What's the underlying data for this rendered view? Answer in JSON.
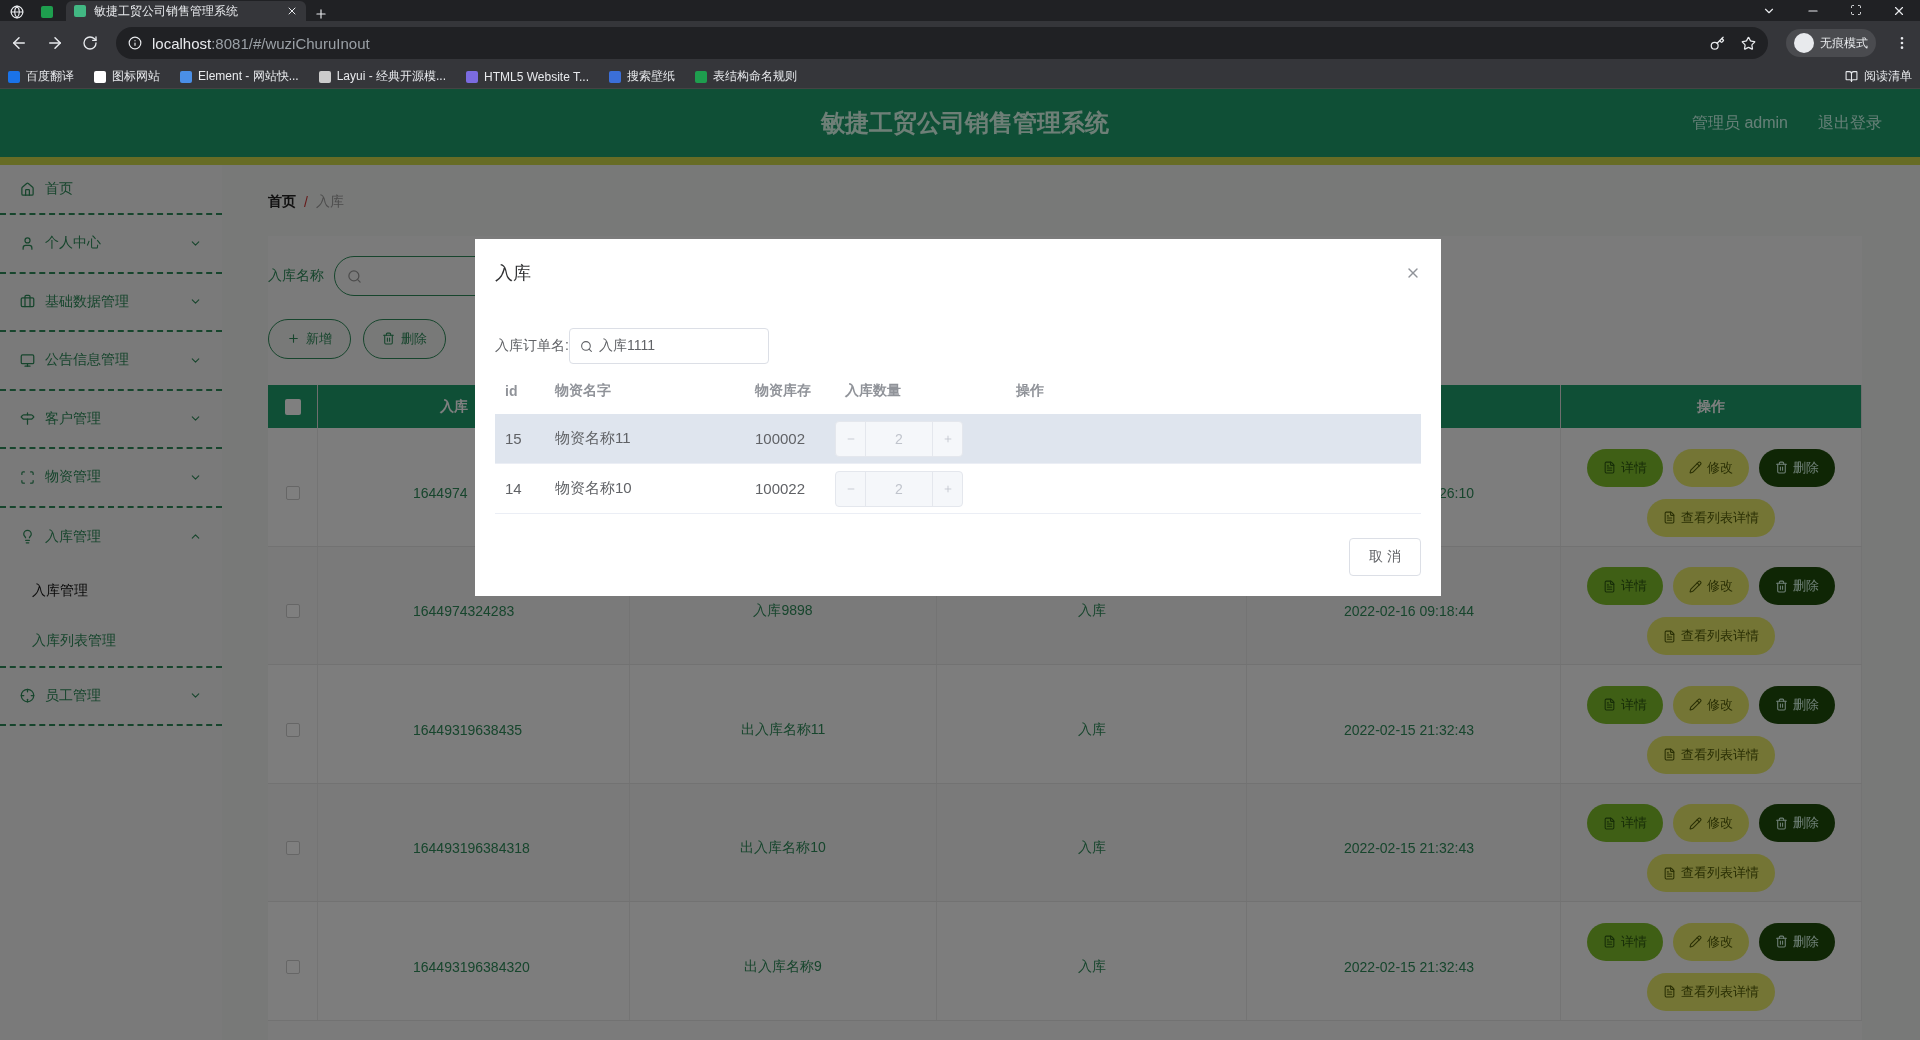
{
  "browser": {
    "tab_title": "敏捷工贸公司销售管理系统",
    "url_host": "localhost",
    "url_rest": ":8081/#/wuziChuruInout",
    "profile": "无痕模式",
    "bookmarks": [
      "百度翻译",
      "图标网站",
      "Element - 网站快...",
      "Layui - 经典开源模...",
      "HTML5 Website T...",
      "搜索壁纸",
      "表结构命名规则"
    ],
    "reading_list": "阅读清单"
  },
  "header": {
    "title": "敏捷工贸公司销售管理系统",
    "user": "管理员 admin",
    "logout": "退出登录"
  },
  "sidebar": {
    "items": [
      {
        "label": "首页",
        "kind": "link"
      },
      {
        "label": "个人中心",
        "kind": "menu",
        "expanded": false
      },
      {
        "label": "基础数据管理",
        "kind": "menu",
        "expanded": false
      },
      {
        "label": "公告信息管理",
        "kind": "menu",
        "expanded": false
      },
      {
        "label": "客户管理",
        "kind": "menu",
        "expanded": false
      },
      {
        "label": "物资管理",
        "kind": "menu",
        "expanded": false
      },
      {
        "label": "入库管理",
        "kind": "menu",
        "expanded": true,
        "children": [
          {
            "label": "入库管理",
            "selected": true
          },
          {
            "label": "入库列表管理",
            "selected": false
          }
        ]
      },
      {
        "label": "员工管理",
        "kind": "menu",
        "expanded": false
      }
    ]
  },
  "breadcrumb": {
    "items": [
      "首页",
      "入库"
    ],
    "separator": "/"
  },
  "search": {
    "label": "入库名称"
  },
  "actions": [
    {
      "label": "新增",
      "kind": "add"
    },
    {
      "label": "删除",
      "kind": "delete"
    }
  ],
  "table": {
    "select_all": {
      "checked": false
    },
    "columns": [
      "入库",
      "操作"
    ],
    "rows": [
      {
        "number": "1644974",
        "time": "26:10",
        "checked": false,
        "actions": [
          "详情",
          "修改",
          "删除",
          "查看列表详情"
        ]
      },
      {
        "number": "1644974324283",
        "name": "入库9898",
        "type": "入库",
        "time": "2022-02-16 09:18:44",
        "checked": false,
        "actions": [
          "详情",
          "修改",
          "删除",
          "查看列表详情"
        ]
      },
      {
        "number": "16449319638435",
        "name": "出入库名称11",
        "type": "入库",
        "time": "2022-02-15 21:32:43",
        "checked": false,
        "actions": [
          "详情",
          "修改",
          "删除",
          "查看列表详情"
        ]
      },
      {
        "number": "164493196384318",
        "name": "出入库名称10",
        "type": "入库",
        "time": "2022-02-15 21:32:43",
        "checked": false,
        "actions": [
          "详情",
          "修改",
          "删除",
          "查看列表详情"
        ]
      },
      {
        "number": "164493196384320",
        "name": "出入库名称9",
        "type": "入库",
        "time": "2022-02-15 21:32:43",
        "checked": false,
        "actions": [
          "详情",
          "修改",
          "删除",
          "查看列表详情"
        ]
      }
    ]
  },
  "dialog": {
    "title": "入库",
    "order_label": "入库订单名:",
    "order_value": "入库1111",
    "columns": [
      "id",
      "物资名字",
      "物资库存",
      "入库数量",
      "操作"
    ],
    "rows": [
      {
        "id": "15",
        "name": "物资名称11",
        "stock": "100002",
        "quantity": "2",
        "highlighted": true
      },
      {
        "id": "14",
        "name": "物资名称10",
        "stock": "100022",
        "quantity": "2",
        "highlighted": false
      }
    ],
    "cancel": "取 消"
  }
}
